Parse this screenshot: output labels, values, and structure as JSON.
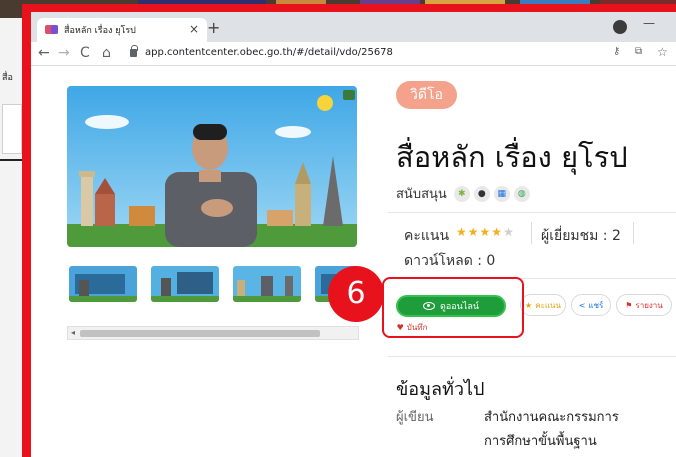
{
  "browser": {
    "tab_title": "สื่อหลัก เรื่อง ยุโรป",
    "tab_close": "×",
    "new_tab": "+",
    "url": "app.contentcenter.obec.go.th/#/detail/vdo/25678",
    "nav": {
      "back": "←",
      "forward": "→",
      "reload": "C",
      "home": "⌂"
    }
  },
  "desktop": {
    "left_label": "สื่อ"
  },
  "content": {
    "type_tag": "วิดีโอ",
    "title": "สื่อหลัก เรื่อง ยุโรป",
    "support_label": "สนับสนุน",
    "platforms": [
      "android-icon",
      "apple-icon",
      "windows-icon",
      "web-icon"
    ],
    "score_label": "คะแนน",
    "rating": 4,
    "rating_max": 5,
    "views": "ผู้เยี่ยมชม : 2",
    "downloads": "ดาวน์โหลด : 0"
  },
  "actions": {
    "watch_online": "ดูออนไลน์",
    "rate": "คะแนน",
    "share": "แชร์",
    "report": "รายงาน",
    "save": "บันทึก"
  },
  "annotation": {
    "step_number": "6",
    "color": "#e8121c"
  },
  "info": {
    "section_title": "ข้อมูลทั่วไป",
    "author_label": "ผู้เขียน",
    "author_line1": "สำนักงานคณะกรรมการ",
    "author_line2": "การศึกษาขั้นพื้นฐาน"
  },
  "colors": {
    "watch_button": "#1f9d3a",
    "type_tag": "#f4a28b",
    "star": "#f2b01e",
    "highlight": "#e8121c"
  }
}
